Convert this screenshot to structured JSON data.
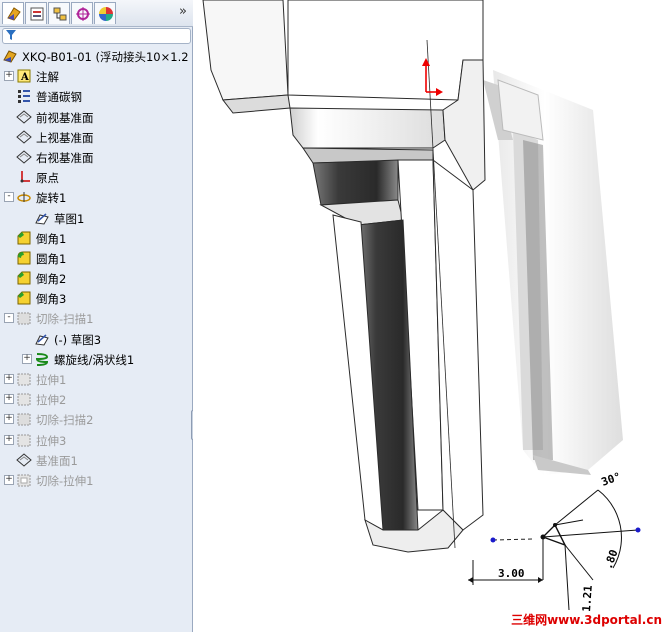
{
  "toolbar": {
    "tabs": [
      {
        "icon": "feature-manager-icon"
      },
      {
        "icon": "property-manager-icon"
      },
      {
        "icon": "configuration-manager-icon"
      },
      {
        "icon": "dimxpert-icon"
      },
      {
        "icon": "display-manager-icon"
      }
    ],
    "more_label": "»"
  },
  "filter": {
    "icon": "filter-icon"
  },
  "tree": [
    {
      "label": "XKQ-B01-01  (浮动接头10×1.2",
      "icon": "part-icon",
      "indent": 0,
      "expander": "",
      "dim": false
    },
    {
      "label": "注解",
      "icon": "annotations-icon",
      "indent": 1,
      "expander": "+",
      "dim": false
    },
    {
      "label": "普通碳钢",
      "icon": "material-icon",
      "indent": 1,
      "expander": "",
      "dim": false
    },
    {
      "label": "前视基准面",
      "icon": "plane-icon",
      "indent": 1,
      "expander": "",
      "dim": false
    },
    {
      "label": "上视基准面",
      "icon": "plane-icon",
      "indent": 1,
      "expander": "",
      "dim": false
    },
    {
      "label": "右视基准面",
      "icon": "plane-icon",
      "indent": 1,
      "expander": "",
      "dim": false
    },
    {
      "label": "原点",
      "icon": "origin-icon",
      "indent": 1,
      "expander": "",
      "dim": false
    },
    {
      "label": "旋转1",
      "icon": "revolve-icon",
      "indent": 1,
      "expander": "-",
      "dim": false
    },
    {
      "label": "草图1",
      "icon": "sketch-icon",
      "indent": 2,
      "expander": "",
      "dim": false
    },
    {
      "label": "倒角1",
      "icon": "chamfer-icon",
      "indent": 1,
      "expander": "",
      "dim": false
    },
    {
      "label": "圆角1",
      "icon": "fillet-icon",
      "indent": 1,
      "expander": "",
      "dim": false
    },
    {
      "label": "倒角2",
      "icon": "chamfer-icon",
      "indent": 1,
      "expander": "",
      "dim": false
    },
    {
      "label": "倒角3",
      "icon": "chamfer-icon",
      "indent": 1,
      "expander": "",
      "dim": false
    },
    {
      "label": "切除-扫描1",
      "icon": "cut-sweep-icon",
      "indent": 1,
      "expander": "-",
      "dim": true
    },
    {
      "label": "(-) 草图3",
      "icon": "sketch-icon",
      "indent": 2,
      "expander": "",
      "dim": false
    },
    {
      "label": "螺旋线/涡状线1",
      "icon": "helix-icon",
      "indent": 2,
      "expander": "+",
      "dim": false
    },
    {
      "label": "拉伸1",
      "icon": "extrude-icon",
      "indent": 1,
      "expander": "+",
      "dim": true
    },
    {
      "label": "拉伸2",
      "icon": "extrude-icon",
      "indent": 1,
      "expander": "+",
      "dim": true
    },
    {
      "label": "切除-扫描2",
      "icon": "cut-sweep-icon",
      "indent": 1,
      "expander": "+",
      "dim": true
    },
    {
      "label": "拉伸3",
      "icon": "extrude-icon",
      "indent": 1,
      "expander": "+",
      "dim": true
    },
    {
      "label": "基准面1",
      "icon": "plane-icon",
      "indent": 1,
      "expander": "",
      "dim": true
    },
    {
      "label": "切除-拉伸1",
      "icon": "cut-extrude-icon",
      "indent": 1,
      "expander": "+",
      "dim": true
    }
  ],
  "dimensions": {
    "d1": "3.00",
    "d2": "1.21",
    "d3": "30°",
    "d4": ".80"
  },
  "watermark": "三维网www.3dportal.cn",
  "colors": {
    "panel_bg": "#e6ecf5",
    "accent_red": "#dd0000",
    "dim_text": "#9a9a9a"
  }
}
